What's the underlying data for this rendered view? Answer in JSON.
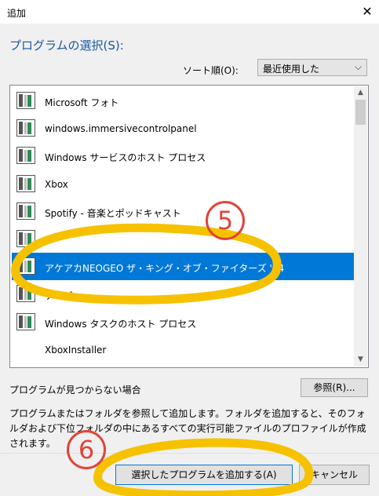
{
  "window": {
    "title": "追加",
    "close_glyph": "✕"
  },
  "heading": "プログラムの選択(S):",
  "sort": {
    "label": "ソート順(O):",
    "selected": "最近使用した",
    "chevron": "⌵"
  },
  "programs": [
    {
      "label": "Microsoft フォト",
      "selected": false
    },
    {
      "label": "windows.immersivecontrolpanel",
      "selected": false
    },
    {
      "label": "Windows サービスのホスト プロセス",
      "selected": false
    },
    {
      "label": "Xbox",
      "selected": false
    },
    {
      "label": "Spotify - 音楽とポッドキャスト",
      "selected": false
    },
    {
      "label": "",
      "selected": false
    },
    {
      "label": "アケアカNEOGEO ザ・キング・オブ・ファイターズ '94",
      "selected": true
    },
    {
      "label": "テレビ",
      "selected": false
    },
    {
      "label": "Windows タスクのホスト プロセス",
      "selected": false
    },
    {
      "label": "XboxInstaller",
      "selected": false
    }
  ],
  "scroll": {
    "up": "▲",
    "down": "▼"
  },
  "not_found": "プログラムが見つからない場合",
  "browse_button": "参照(R)...",
  "description": "プログラムまたはフォルダを参照して追加します。フォルダを追加すると、そのフォルダおよび下位フォルダの中にあるすべての実行可能ファイルのプロファイルが作成されます。",
  "add_button": "選択したプログラムを追加する(A)",
  "cancel_button": "キャンセル",
  "annotations": {
    "step5": "5",
    "step6": "6",
    "highlight_color": "#f6c200",
    "number_color": "#e0443a"
  },
  "colors": {
    "accent": "#0078d7",
    "heading": "#1a55a4"
  }
}
